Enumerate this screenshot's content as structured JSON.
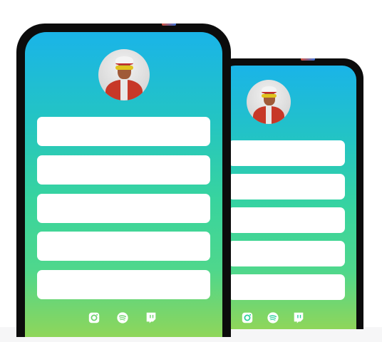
{
  "front_profile": {
    "avatar": "profile-photo",
    "links": [
      {
        "label": ""
      },
      {
        "label": ""
      },
      {
        "label": ""
      },
      {
        "label": ""
      },
      {
        "label": ""
      }
    ],
    "social_icons": [
      "instagram-icon",
      "spotify-icon",
      "twitch-icon"
    ]
  },
  "back_profile": {
    "avatar": "profile-photo",
    "links": [
      {
        "label": ""
      },
      {
        "label": ""
      },
      {
        "label": ""
      },
      {
        "label": ""
      },
      {
        "label": ""
      }
    ],
    "social_icons": [
      "instagram-icon",
      "spotify-icon",
      "twitch-icon"
    ]
  },
  "colors": {
    "gradient_top": "#1ab4e8",
    "gradient_mid": "#38d49e",
    "gradient_bottom": "#8fd65a",
    "phone_frame": "#0c0c0c",
    "link_box": "#ffffff"
  }
}
